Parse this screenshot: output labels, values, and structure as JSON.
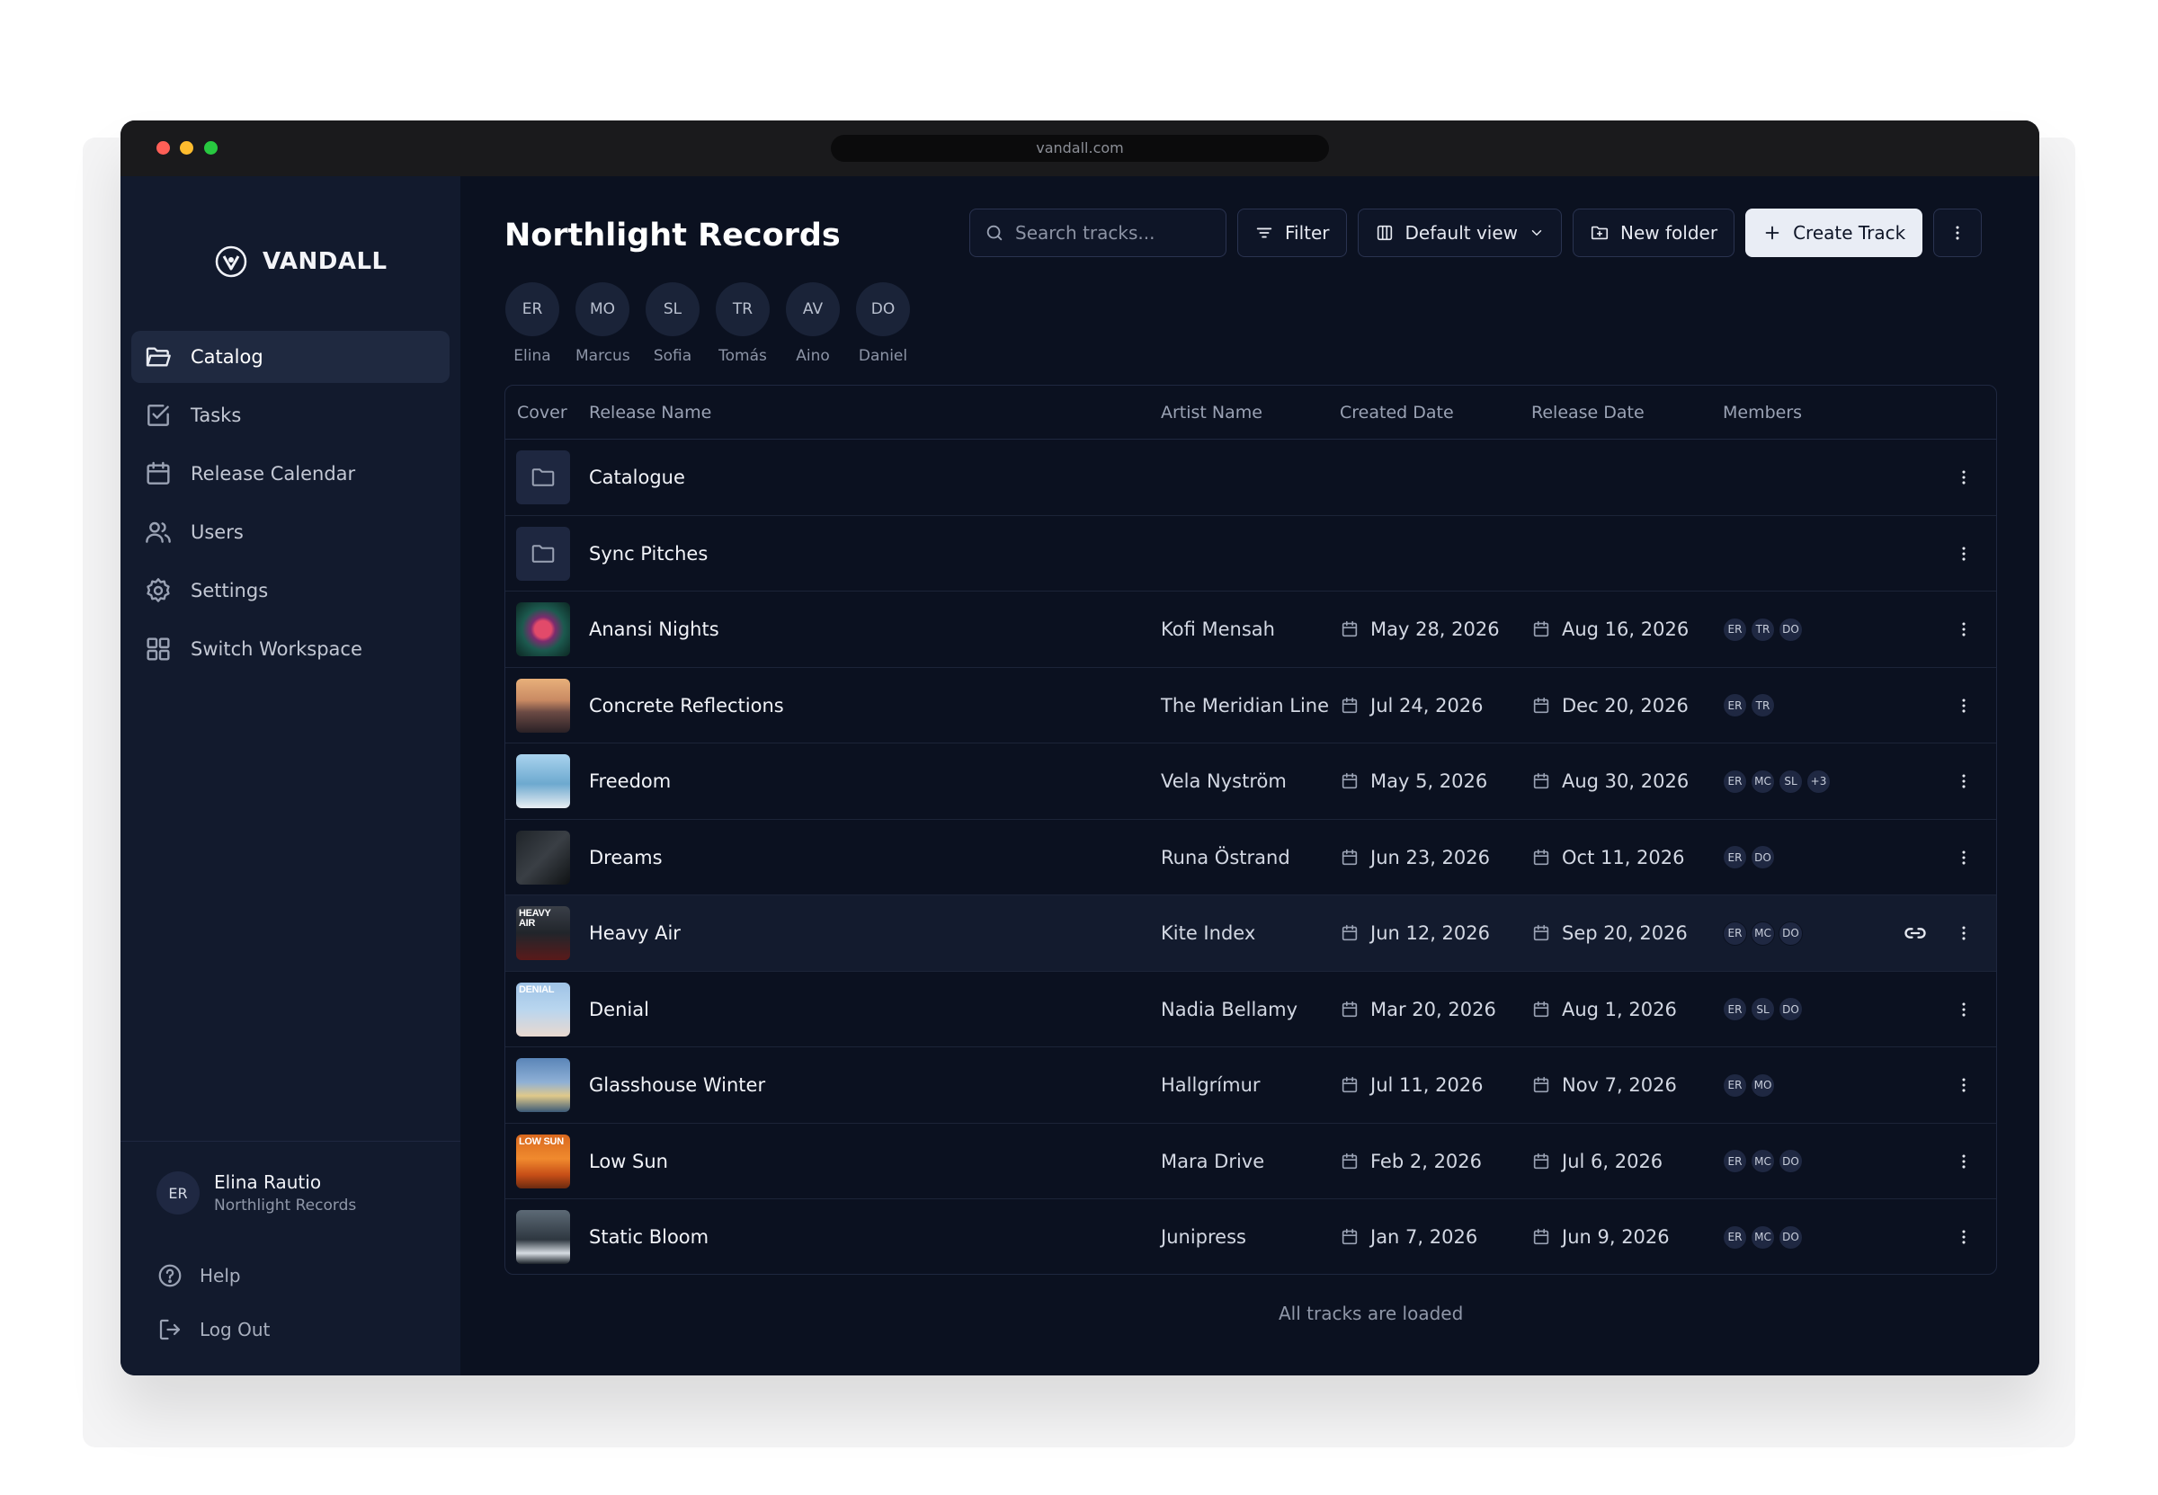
{
  "browser": {
    "url": "vandall.com"
  },
  "brand": {
    "name": "VANDALL",
    "logo_icon": "shield-v-icon"
  },
  "sidebar": {
    "items": [
      {
        "label": "Catalog",
        "icon": "folder-icon",
        "active": true
      },
      {
        "label": "Tasks",
        "icon": "checkbox-icon",
        "active": false
      },
      {
        "label": "Release Calendar",
        "icon": "calendar-icon",
        "active": false
      },
      {
        "label": "Users",
        "icon": "users-icon",
        "active": false
      },
      {
        "label": "Settings",
        "icon": "gear-icon",
        "active": false
      },
      {
        "label": "Switch Workspace",
        "icon": "grid-icon",
        "active": false
      }
    ],
    "user": {
      "initials": "ER",
      "name": "Elina Rautio",
      "org": "Northlight Records"
    },
    "help_label": "Help",
    "logout_label": "Log Out"
  },
  "header": {
    "title": "Northlight Records",
    "search_placeholder": "Search tracks...",
    "filter_label": "Filter",
    "view_label": "Default view",
    "new_folder_label": "New folder",
    "create_label": "Create Track"
  },
  "members": [
    {
      "initials": "ER",
      "name": "Elina"
    },
    {
      "initials": "MO",
      "name": "Marcus"
    },
    {
      "initials": "SL",
      "name": "Sofia"
    },
    {
      "initials": "TR",
      "name": "Tomás"
    },
    {
      "initials": "AV",
      "name": "Aino"
    },
    {
      "initials": "DO",
      "name": "Daniel"
    }
  ],
  "table": {
    "columns": [
      "Cover",
      "Release Name",
      "Artist Name",
      "Created Date",
      "Release Date",
      "Members"
    ],
    "folders": [
      {
        "name": "Catalogue"
      },
      {
        "name": "Sync Pitches"
      }
    ],
    "tracks": [
      {
        "name": "Anansi Nights",
        "artist": "Kofi Mensah",
        "created": "May 28, 2026",
        "release": "Aug 16, 2026",
        "members": [
          "ER",
          "TR",
          "DO"
        ]
      },
      {
        "name": "Concrete Reflections",
        "artist": "The Meridian Line",
        "created": "Jul 24, 2026",
        "release": "Dec 20, 2026",
        "members": [
          "ER",
          "TR"
        ]
      },
      {
        "name": "Freedom",
        "artist": "Vela Nyström",
        "created": "May 5, 2026",
        "release": "Aug 30, 2026",
        "members": [
          "ER",
          "MC",
          "SL",
          "+3"
        ]
      },
      {
        "name": "Dreams",
        "artist": "Runa Östrand",
        "created": "Jun 23, 2026",
        "release": "Oct 11, 2026",
        "members": [
          "ER",
          "DO"
        ]
      },
      {
        "name": "Heavy Air",
        "artist": "Kite Index",
        "created": "Jun 12, 2026",
        "release": "Sep 20, 2026",
        "members": [
          "ER",
          "MC",
          "DO"
        ],
        "highlighted": true,
        "cover_text": "HEAVY AIR"
      },
      {
        "name": "Denial",
        "artist": "Nadia Bellamy",
        "created": "Mar 20, 2026",
        "release": "Aug 1, 2026",
        "members": [
          "ER",
          "SL",
          "DO"
        ],
        "cover_text": "DENIAL"
      },
      {
        "name": "Glasshouse Winter",
        "artist": "Hallgrímur",
        "created": "Jul 11, 2026",
        "release": "Nov 7, 2026",
        "members": [
          "ER",
          "MO"
        ]
      },
      {
        "name": "Low Sun",
        "artist": "Mara Drive",
        "created": "Feb 2, 2026",
        "release": "Jul 6, 2026",
        "members": [
          "ER",
          "MC",
          "DO"
        ],
        "cover_text": "LOW SUN"
      },
      {
        "name": "Static Bloom",
        "artist": "Junipress",
        "created": "Jan 7, 2026",
        "release": "Jun 9, 2026",
        "members": [
          "ER",
          "MC",
          "DO"
        ]
      }
    ]
  },
  "footer": {
    "status": "All tracks are loaded"
  }
}
